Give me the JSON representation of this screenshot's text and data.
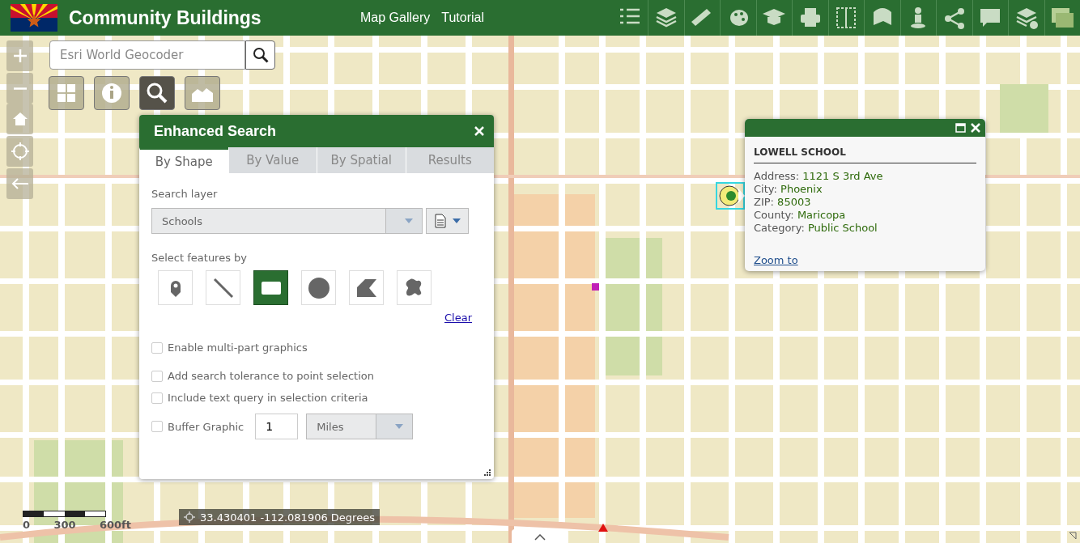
{
  "header": {
    "title": "Community Buildings",
    "links": [
      "Map Gallery",
      "Tutorial"
    ]
  },
  "geocoder": {
    "placeholder": "Esri World Geocoder"
  },
  "widgets": [
    {
      "selected": false
    },
    {
      "selected": false
    },
    {
      "selected": true
    },
    {
      "selected": false
    }
  ],
  "search_panel": {
    "title": "Enhanced Search",
    "tabs": [
      {
        "label": "By Shape",
        "selected": true
      },
      {
        "label": "By Value",
        "selected": false
      },
      {
        "label": "By Spatial",
        "selected": false
      },
      {
        "label": "Results",
        "selected": false
      }
    ],
    "layer_label": "Search layer",
    "layer_value": "Schools",
    "select_label": "Select features by",
    "draw_tools": [
      {
        "selected": false
      },
      {
        "selected": false
      },
      {
        "selected": true
      },
      {
        "selected": false
      },
      {
        "selected": false
      },
      {
        "selected": false
      }
    ],
    "clear_link": "Clear",
    "options": [
      {
        "label": "Enable multi-part graphics",
        "checked": false
      },
      {
        "label": "Add search tolerance to point selection",
        "checked": false
      },
      {
        "label": "Include text query in selection criteria",
        "checked": false
      }
    ],
    "buffer": {
      "label": "Buffer Graphic",
      "checked": false,
      "distance": "1",
      "unit": "Miles"
    }
  },
  "popup": {
    "title": "LOWELL SCHOOL",
    "fields": [
      {
        "label": "Address:",
        "value": "1121 S 3rd Ave"
      },
      {
        "label": "City:",
        "value": "Phoenix"
      },
      {
        "label": "ZIP:",
        "value": "85003"
      },
      {
        "label": "County:",
        "value": "Maricopa"
      },
      {
        "label": "Category:",
        "value": "Public School"
      }
    ],
    "link": "Zoom to"
  },
  "scale_bar": [
    "0",
    "300",
    "600ft"
  ],
  "coordinates": "33.430401 -112.081906 Degrees"
}
